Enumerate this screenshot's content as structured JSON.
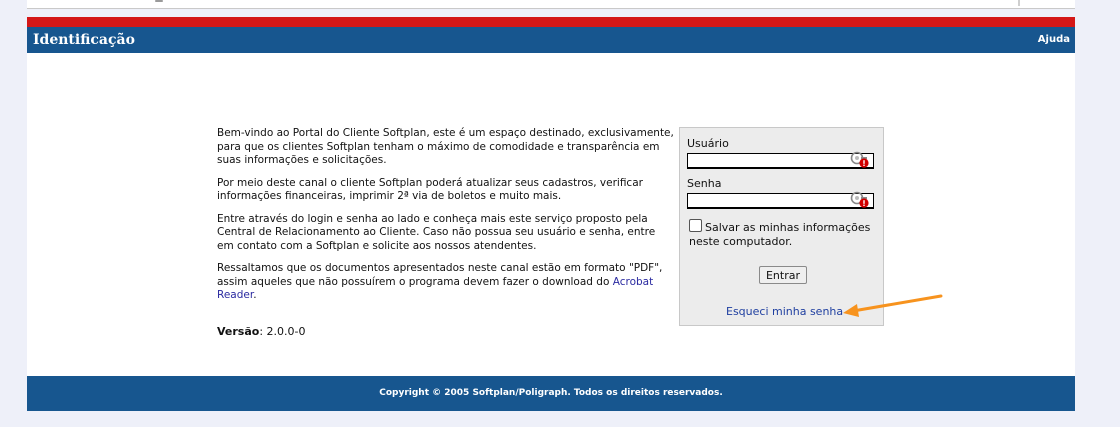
{
  "header": {
    "title": "Identificação",
    "help_label": "Ajuda"
  },
  "intro": {
    "paragraph1": "Bem-vindo ao Portal do Cliente Softplan, este é um espaço destinado, exclusivamente, para que os clientes Softplan tenham o máximo de comodidade e transparência em suas informações e solicitações.",
    "paragraph2": "Por meio deste canal o cliente Softplan poderá atualizar seus cadastros, verificar informações financeiras, imprimir 2ª via de boletos e muito mais.",
    "paragraph3": "Entre através do login e senha ao lado e conheça mais este serviço proposto pela Central de Relacionamento ao Cliente. Caso não possua seu usuário e senha, entre em contato com a Softplan e solicite aos nossos atendentes.",
    "paragraph4_text": "Ressaltamos que os documentos apresentados neste canal estão em formato \"PDF\", assim aqueles que não possuírem o programa devem fazer o download do",
    "acrobat_link": "Acrobat Reader",
    "paragraph4_end": ".",
    "version_label": "Versão",
    "version_value": ": 2.0.0-0"
  },
  "login": {
    "user_label": "Usuário",
    "user_value": "",
    "password_label": "Senha",
    "password_value": "",
    "save_label": "Salvar as minhas informações neste computador.",
    "save_checked": false,
    "enter_label": "Entrar",
    "forgot_label": "Esqueci minha senha"
  },
  "footer": {
    "copyright": "Copyright © 2005 Softplan/Poligraph. Todos os direitos reservados."
  },
  "colors": {
    "brand_blue": "#17568f",
    "accent_red": "#d41717",
    "annotation_orange": "#f7931e"
  },
  "icons": [
    "key-warning-icon",
    "arrow-annotation"
  ]
}
